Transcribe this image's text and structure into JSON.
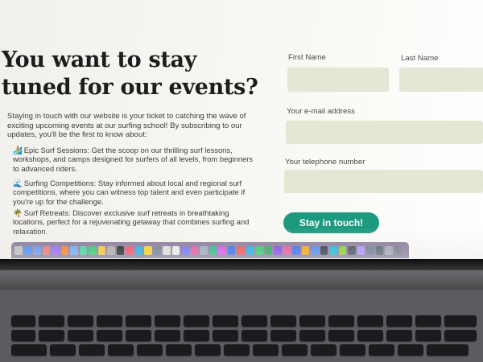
{
  "page": {
    "headline": "You want to stay tuned for our events?",
    "intro": "Staying in touch with our website is your ticket to catching the wave of exciting upcoming events at our surfing school! By subscribing to our updates, you'll be the first to know about:",
    "features": [
      {
        "icon": "surfer-icon",
        "glyph": "🏄",
        "text": "Epic Surf Sessions: Get the scoop on our thrilling surf lessons, workshops, and camps designed for surfers of all levels, from beginners to advanced riders."
      },
      {
        "icon": "wave-icon",
        "glyph": "🌊",
        "text": "Surfing Competitions: Stay informed about local and regional surf competitions, where you can witness top talent and even participate if you're up for the challenge."
      },
      {
        "icon": "palm-tree-icon",
        "glyph": "🌴",
        "text": "Surf Retreats: Discover exclusive surf retreats in breathtaking locations, perfect for a rejuvenating getaway that combines surfing and relaxation."
      }
    ]
  },
  "form": {
    "first_name_label": "First Name",
    "last_name_label": "Last Name",
    "email_label": "Your e-mail address",
    "phone_label": "Your telephone number",
    "first_name_value": "",
    "last_name_value": "",
    "email_value": "",
    "phone_value": "",
    "submit_label": "Stay in touch!"
  },
  "colors": {
    "accent": "#1c9a80",
    "field_bg": "#e6e6d4"
  },
  "dock": {
    "icons": [
      "#b9b9b9",
      "#3b82f6",
      "#5b8def",
      "#e86a6a",
      "#8b5cf6",
      "#f97316",
      "#60a5fa",
      "#34d399",
      "#22c55e",
      "#fbbf24",
      "#a3a3a3",
      "#111111",
      "#f43f5e",
      "#0ea5e9",
      "#facc15",
      "#64748b",
      "#dddddd",
      "#eeeeee",
      "#6366f1",
      "#ec4899",
      "#94a3b8",
      "#10b981",
      "#d946ef",
      "#2563eb",
      "#ef4444",
      "#0ea5e9",
      "#22c55e",
      "#16a34a",
      "#7c3aed",
      "#ec4899",
      "#2563eb",
      "#f59e0b",
      "#3b82f6",
      "#1f2937",
      "#06b6d4",
      "#84cc16",
      "#334155",
      "#a78bfa",
      "#64748b",
      "#4b5563",
      "#9ca3af",
      "#6b7280"
    ]
  }
}
